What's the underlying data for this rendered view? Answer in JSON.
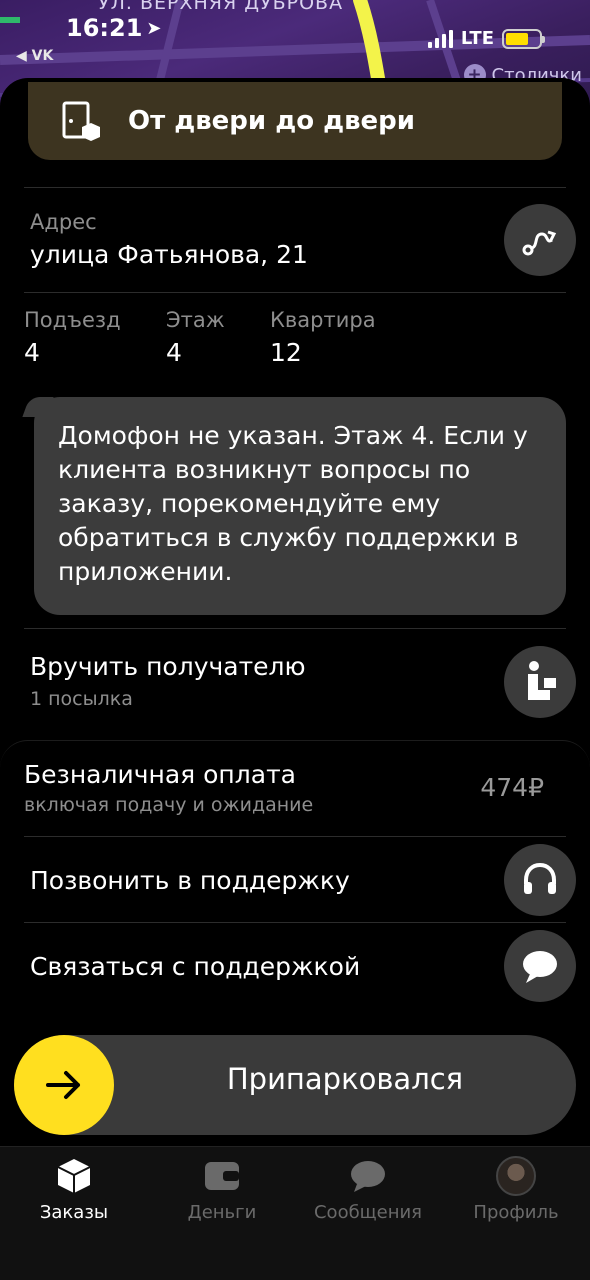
{
  "status_bar": {
    "time": "16:21",
    "back_app": "◀ VK",
    "network": "LTE"
  },
  "map": {
    "street": "ул. ВЕРХНЯЯ ДУБРОВА",
    "poi": "Столички"
  },
  "order": {
    "delivery_type": "От двери до двери",
    "address_caption": "Адрес",
    "address": "улица Фатьянова, 21",
    "entrance_caption": "Подъезд",
    "entrance": "4",
    "floor_caption": "Этаж",
    "floor": "4",
    "apartment_caption": "Квартира",
    "apartment": "12",
    "note": "Домофон не указан. Этаж 4. Если у клиента возникнут вопросы по заказу, порекомендуйте ему обратиться в службу поддержки в приложении.",
    "handover_title": "Вручить получателю",
    "handover_sub": "1 посылка"
  },
  "payment": {
    "title": "Безналичная оплата",
    "subtitle": "включая подачу и ожидание",
    "amount": "474₽"
  },
  "support": {
    "call": "Позвонить в поддержку",
    "chat": "Связаться с поддержкой"
  },
  "slider": {
    "label": "Припарковался"
  },
  "tabs": [
    {
      "label": "Заказы",
      "icon": "orders-box-icon"
    },
    {
      "label": "Деньги",
      "icon": "wallet-icon"
    },
    {
      "label": "Сообщения",
      "icon": "chat-bubble-icon"
    },
    {
      "label": "Профиль",
      "icon": "profile-avatar"
    }
  ],
  "colors": {
    "accent_yellow": "#ffdf1f",
    "banner_bg": "#3d3420",
    "bubble_bg": "#3c3c3c",
    "map_purple": "#4b2a7a"
  }
}
